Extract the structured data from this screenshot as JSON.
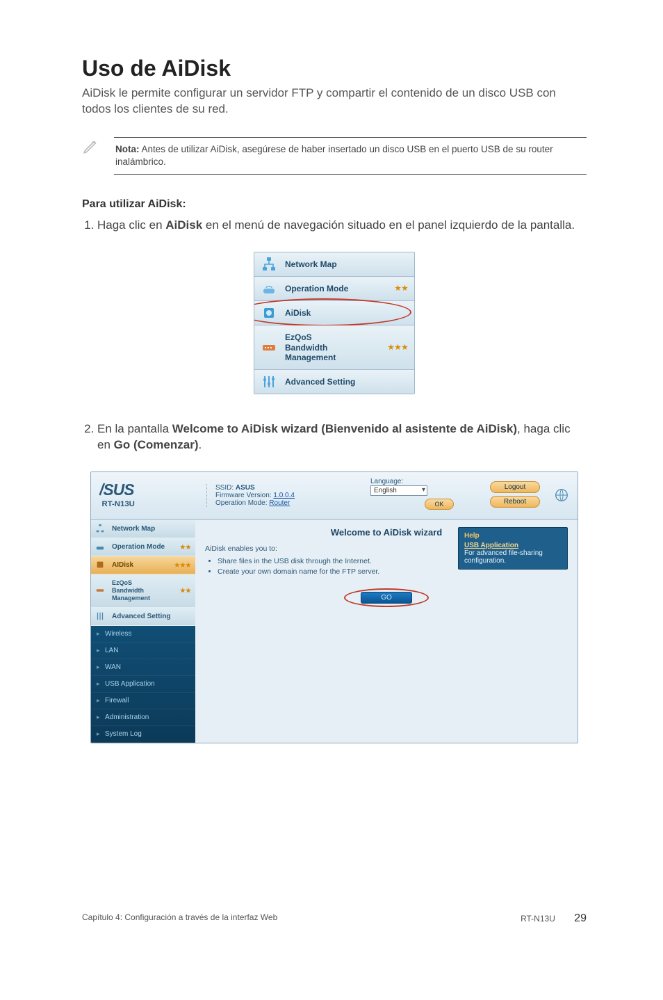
{
  "title": "Uso de AiDisk",
  "intro": "AiDisk le permite configurar un servidor FTP y compartir el contenido de un disco USB con todos los clientes de su red.",
  "note": {
    "label": "Nota:",
    "text": " Antes de utilizar AiDisk, asegúrese de haber insertado un disco USB en el puerto USB de su router inalámbrico."
  },
  "section_head": "Para utilizar AiDisk:",
  "steps": {
    "s1_a": "Haga clic en ",
    "s1_b": "AiDisk",
    "s1_c": " en el menú de navegación situado en el panel izquierdo de la pantalla.",
    "s2_a": "En la pantalla ",
    "s2_b": "Welcome to AiDisk wizard (Bienvenido al asistente de AiDisk)",
    "s2_c": ", haga clic en ",
    "s2_d": "Go (Comenzar)",
    "s2_e": "."
  },
  "fig1": {
    "items": [
      {
        "label": "Network Map"
      },
      {
        "label": "Operation Mode"
      },
      {
        "label": "AiDisk"
      },
      {
        "label_html": "EzQoS\nBandwidth\nManagement"
      },
      {
        "label": "Advanced Setting"
      }
    ]
  },
  "fig2": {
    "ssid_label": "SSID:",
    "ssid_value": "ASUS",
    "fw_label": "Firmware Version:",
    "fw_value": "1.0.0.4",
    "opmode_label": "Operation Mode:",
    "opmode_value": "Router",
    "lang_label": "Language:",
    "lang_value": "English",
    "btn_logout": "Logout",
    "btn_reboot": "Reboot",
    "btn_ok": "OK",
    "model": "RT-N13U",
    "side_primary": [
      "Network Map",
      "Operation Mode",
      "AIDisk",
      "EzQoS Bandwidth Management",
      "Advanced Setting"
    ],
    "side_advanced": [
      "Wireless",
      "LAN",
      "WAN",
      "USB Application",
      "Firewall",
      "Administration",
      "System Log"
    ],
    "wizard_title": "Welcome to AiDisk wizard",
    "wizard_intro": "AiDisk enables you to:",
    "wizard_list": [
      "Share files in the USB disk through the Internet.",
      "Create your own domain name for the FTP server."
    ],
    "go": "GO",
    "help_head": "Help",
    "help_link": "USB Application",
    "help_text": "For advanced file-sharing configuration."
  },
  "footer": {
    "left": "Capítulo 4: Configuración a través de la interfaz Web",
    "right": "RT-N13U",
    "page": "29"
  }
}
